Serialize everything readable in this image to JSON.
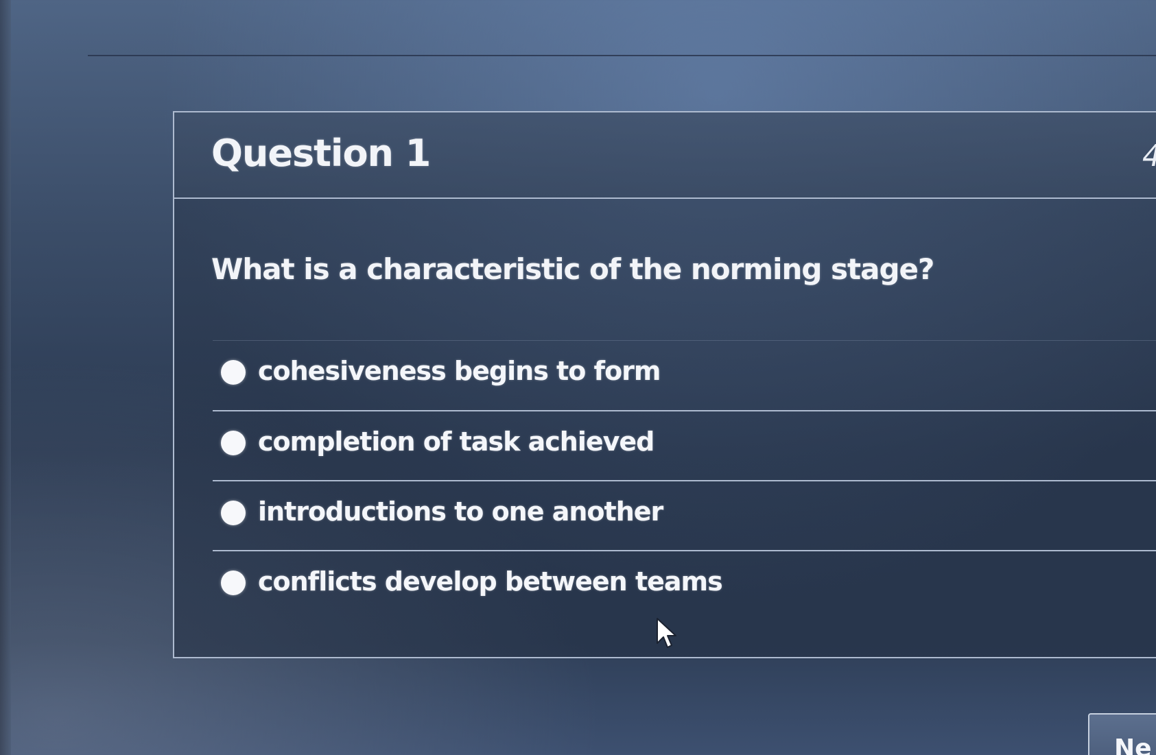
{
  "question": {
    "title": "Question 1",
    "points_partial": "4",
    "text": "What is a characteristic of the norming stage?",
    "answers": [
      {
        "label": "cohesiveness begins to form"
      },
      {
        "label": "completion of task achieved"
      },
      {
        "label": "introductions to one another"
      },
      {
        "label": "conflicts develop between teams"
      }
    ]
  },
  "navigation": {
    "next_label_partial": "Ne"
  },
  "icons": {
    "cursor": "mouse-pointer-icon",
    "radio": "radio-button"
  },
  "colors": {
    "background": "#3b4d68",
    "card_border": "#aebbd0",
    "text": "#f4f6fa"
  }
}
